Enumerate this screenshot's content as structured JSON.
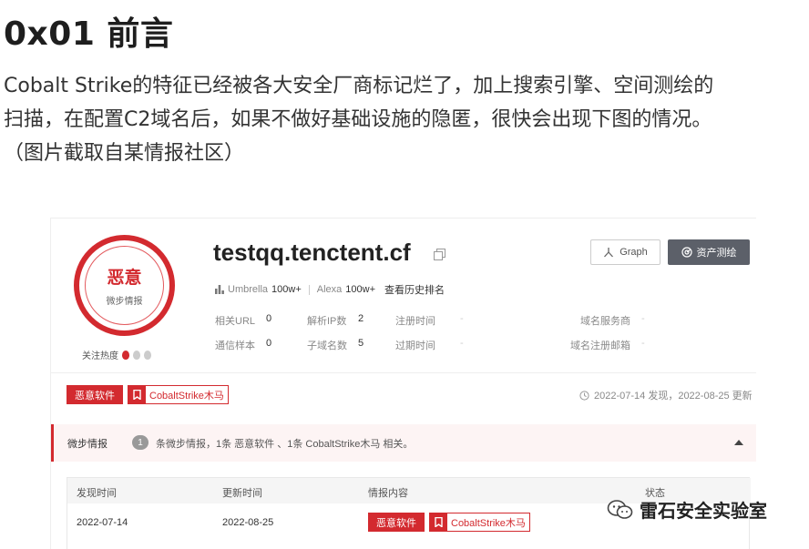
{
  "article": {
    "heading": "0x01 前言",
    "paragraph_line1": "Cobalt Strike的特征已经被各大安全厂商标记烂了，加上搜索引擎、空间测绘的",
    "paragraph_line2": "扫描，在配置C2域名后，如果不做好基础设施的隐匿，很快会出现下图的情况。",
    "paragraph_line3": "（图片截取自某情报社区）"
  },
  "screenshot": {
    "verdict": {
      "title": "恶意",
      "subtitle": "微步情报"
    },
    "heat": {
      "label": "关注热度",
      "level": 1,
      "max": 3
    },
    "domain": "testqq.tenctent.cf",
    "buttons": {
      "graph": "Graph",
      "assets": "资产测绘"
    },
    "ranks": {
      "umbrella_label": "Umbrella",
      "umbrella_value": "100w+",
      "alexa_label": "Alexa",
      "alexa_value": "100w+",
      "history": "查看历史排名"
    },
    "stats": {
      "related_url_label": "相关URL",
      "related_url_value": "0",
      "resolved_ip_label": "解析IP数",
      "resolved_ip_value": "2",
      "reg_time_label": "注册时间",
      "reg_time_value": "-",
      "registrar_label": "域名服务商",
      "registrar_value": "-",
      "comm_samples_label": "通信样本",
      "comm_samples_value": "0",
      "subdomains_label": "子域名数",
      "subdomains_value": "5",
      "expire_label": "过期时间",
      "expire_value": "-",
      "reg_email_label": "域名注册邮箱",
      "reg_email_value": "-"
    },
    "tags": {
      "malware": "恶意软件",
      "trojan": "CobaltStrike木马"
    },
    "found_text": "2022-07-14 发现，2022-08-25 更新",
    "intel": {
      "title": "微步情报",
      "count": "1",
      "desc": "条微步情报，1条 恶意软件 、1条 CobaltStrike木马 相关。"
    },
    "table": {
      "headers": [
        "发现时间",
        "更新时间",
        "情报内容",
        "状态"
      ],
      "row": {
        "found": "2022-07-14",
        "updated": "2022-08-25"
      }
    }
  },
  "watermark": {
    "text": "雷石安全实验室"
  }
}
